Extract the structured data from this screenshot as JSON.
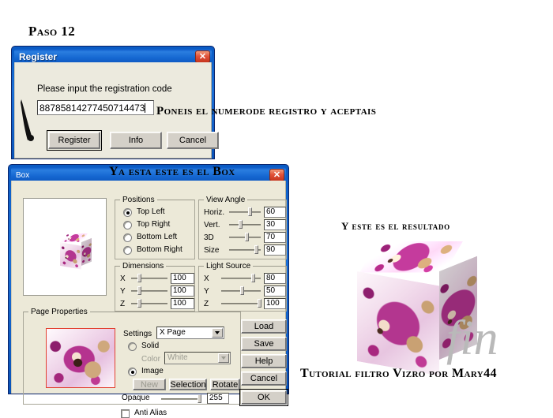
{
  "annotations": {
    "paso": "Paso 12",
    "code_note": "Poneis el numerode registro y aceptais",
    "box_title_note": "Ya esta este es el Box",
    "result_note": "Y este es el resultado",
    "credit": "Tutorial filtro Vizro por Mary44",
    "watermark": "fin"
  },
  "register_dialog": {
    "title": "Register",
    "close_icon": "close-icon",
    "prompt": "Please input the registration code",
    "code_value": "88785814277450714473",
    "code_placeholder": "",
    "buttons": [
      "Register",
      "Info",
      "Cancel"
    ]
  },
  "box_dialog": {
    "title": "Box",
    "close_icon": "close-icon",
    "positions": {
      "legend": "Positions",
      "options": [
        "Top Left",
        "Top Right",
        "Bottom Left",
        "Bottom Right"
      ],
      "selected": "Top Left"
    },
    "view_angle": {
      "legend": "View Angle",
      "rows": [
        {
          "label": "Horiz.",
          "value": "60",
          "pct": 60
        },
        {
          "label": "Vert.",
          "value": "30",
          "pct": 30
        },
        {
          "label": "3D",
          "value": "70",
          "pct": 70
        },
        {
          "label": "Size",
          "value": "90",
          "pct": 90
        }
      ]
    },
    "dimensions": {
      "legend": "Dimensions",
      "rows": [
        {
          "label": "X",
          "value": "100",
          "pct": 22
        },
        {
          "label": "Y",
          "value": "100",
          "pct": 22
        },
        {
          "label": "Z",
          "value": "100",
          "pct": 22
        }
      ]
    },
    "light_source": {
      "legend": "Light Source",
      "rows": [
        {
          "label": "X",
          "value": "80",
          "pct": 80
        },
        {
          "label": "Y",
          "value": "50",
          "pct": 50
        },
        {
          "label": "Z",
          "value": "100",
          "pct": 100
        }
      ]
    },
    "page_properties": {
      "legend": "Page Properties",
      "settings_label": "Settings",
      "settings_value": "X Page",
      "solid_label": "Solid",
      "color_label": "Color",
      "color_value": "White",
      "image_label": "Image",
      "fill_selected": "Image",
      "image_buttons": [
        "New",
        "Selection",
        "Rotate"
      ],
      "opaque_label": "Opaque",
      "opaque_value": "255",
      "opaque_pct": 100,
      "anti_alias_label": "Anti Alias",
      "anti_alias_checked": false
    },
    "side_buttons": [
      "Load",
      "Save",
      "Help",
      "Cancel",
      "OK"
    ]
  },
  "colors": {
    "titlebar_blue": "#1668d2",
    "close_red": "#c5341d",
    "dialog_face": "#ece9d8",
    "button_face": "#d4d0c8",
    "thumb_border_red": "#e2402f",
    "accent_magenta": "#b3368f"
  }
}
